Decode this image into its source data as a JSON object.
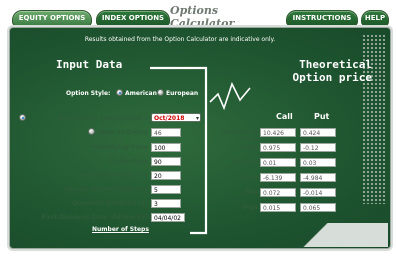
{
  "header": {
    "tabs": [
      "EQUITY OPTIONS",
      "INDEX OPTIONS",
      "INSTRUCTIONS",
      "HELP"
    ],
    "title": "Options Calculator"
  },
  "disclaimer": "Results obtained from the Option Calculator are indicative only.",
  "input": {
    "heading": "Input Data",
    "option_style_label": "Option Style:",
    "style_options": [
      "American",
      "European"
    ],
    "expiry_label": "Expiry Date ( Month/Year )",
    "expiry_value": "Oct/2018",
    "days_label": "Days to Expiry",
    "days_value": "46",
    "underlying_label": "Underlying Price",
    "underlying_value": "100",
    "strike_label": "Strike Price",
    "strike_value": "90",
    "vol_label": "Annual Volatility (%)",
    "vol_value": "20",
    "rate_label": "Annual Interest Rate (%)",
    "rate_value": "5",
    "div_label": "Quarterly Dividend ($)",
    "div_value": "3",
    "first_div_label": "First Dividend Date (dd/mm/yy)",
    "first_div_value": "04/04/02",
    "steps_label": "Number of Steps"
  },
  "output": {
    "heading_line1": "Theoretical",
    "heading_line2": "Option price",
    "col_call": "Call",
    "col_put": "Put",
    "rows": [
      {
        "label": "Theoretical Price",
        "call": "10.426",
        "put": "0.424"
      },
      {
        "label": "Delta",
        "call": "0.975",
        "put": "-0.12"
      },
      {
        "label": "Gamma",
        "call": "0.01",
        "put": "0.03"
      },
      {
        "label": "Theta",
        "call": "-6.139",
        "put": "-4.984"
      },
      {
        "label": "Rho",
        "call": "0.072",
        "put": "-0.014"
      },
      {
        "label": "Vega",
        "call": "0.015",
        "put": "0.065"
      }
    ]
  },
  "colors": {
    "panel": "#1f5530",
    "label_green": "#2f5c3a",
    "selected_red": "#cc0000"
  }
}
